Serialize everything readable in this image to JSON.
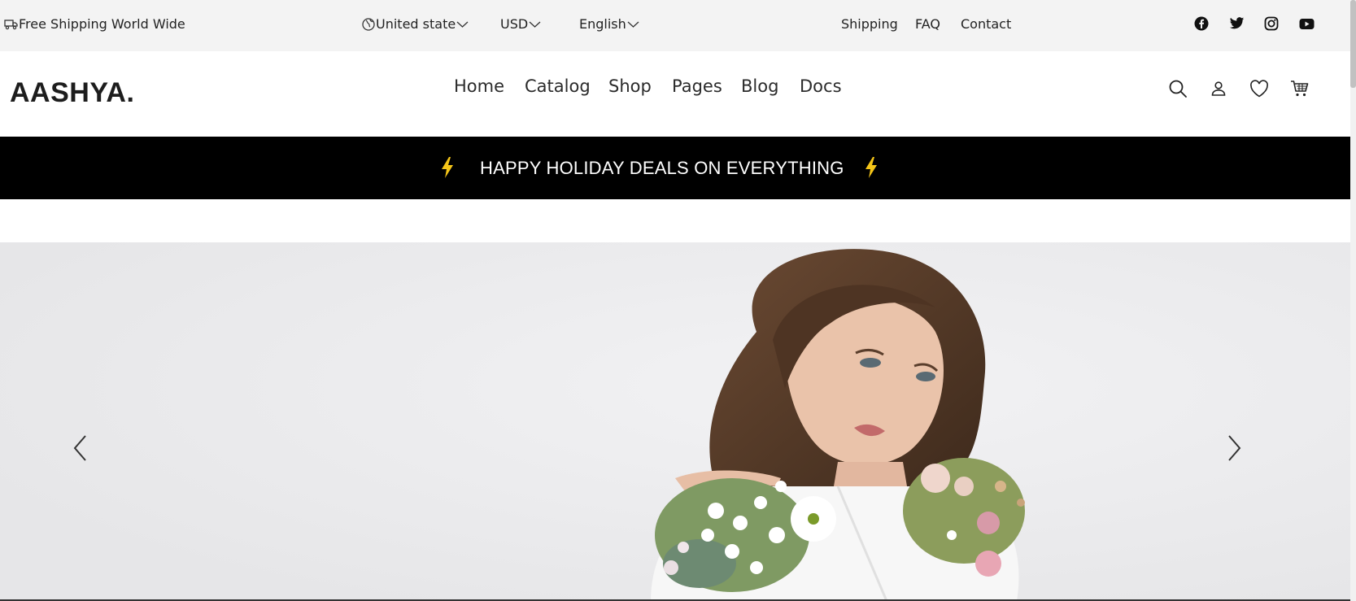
{
  "topbar": {
    "shipping_text": "Free Shipping World Wide",
    "country": "United state",
    "currency": "USD",
    "language": "English",
    "links": [
      "Shipping",
      "FAQ",
      "Contact"
    ],
    "social_icons": [
      "facebook-icon",
      "twitter-icon",
      "instagram-icon",
      "youtube-icon"
    ]
  },
  "header": {
    "logo": "AASHYA.",
    "nav": [
      "Home",
      "Catalog",
      "Shop",
      "Pages",
      "Blog",
      "Docs"
    ],
    "icons": [
      "search-icon",
      "user-icon",
      "heart-icon",
      "cart-icon"
    ]
  },
  "promo": {
    "text": "HAPPY HOLIDAY DEALS ON EVERYTHING",
    "accent_color": "#f5c518"
  },
  "hero": {
    "background_color": "#e9e9eb",
    "image_subject": "woman-with-flower-bouquets",
    "controls": [
      "chevron-left-icon",
      "chevron-right-icon"
    ]
  }
}
